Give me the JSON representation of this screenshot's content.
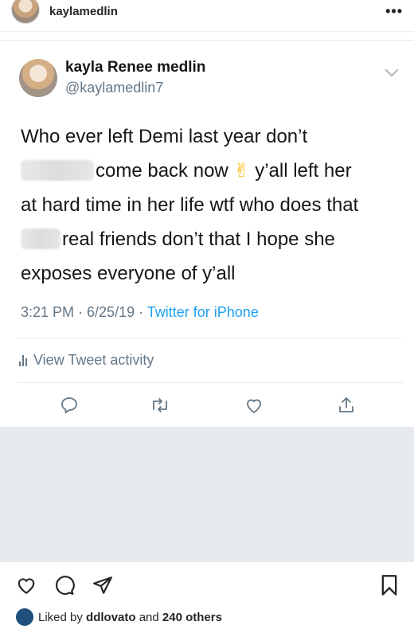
{
  "post_header": {
    "username": "kaylamedlin",
    "more_icon": "more-dots-icon"
  },
  "tweet": {
    "display_name": "kayla Renee medlin",
    "handle": "@kaylamedlin7",
    "text": {
      "line1": "Who ever left Demi last year don’t",
      "line2_after_redaction": "come back now",
      "emoji": "✌",
      "line2_end": " y’all left her",
      "line3": "at hard time in her life wtf who does that",
      "line4_after_redaction": "real friends don’t that I hope she",
      "line5": "exposes everyone of y’all"
    },
    "timestamp": "3:21 PM · 6/25/19 · ",
    "source": "Twitter for iPhone",
    "activity_label": "View Tweet activity",
    "actions": [
      "reply-icon",
      "retweet-icon",
      "like-icon",
      "share-icon"
    ],
    "colors": {
      "link": "#1da1f2",
      "muted": "#657786",
      "text": "#14171a"
    }
  },
  "ig_actions": [
    "heart-icon",
    "comment-icon",
    "send-icon",
    "bookmark-icon"
  ],
  "likes": {
    "prefix": "Liked by ",
    "user": "ddlovato",
    "middle": " and ",
    "others": "240 others"
  }
}
